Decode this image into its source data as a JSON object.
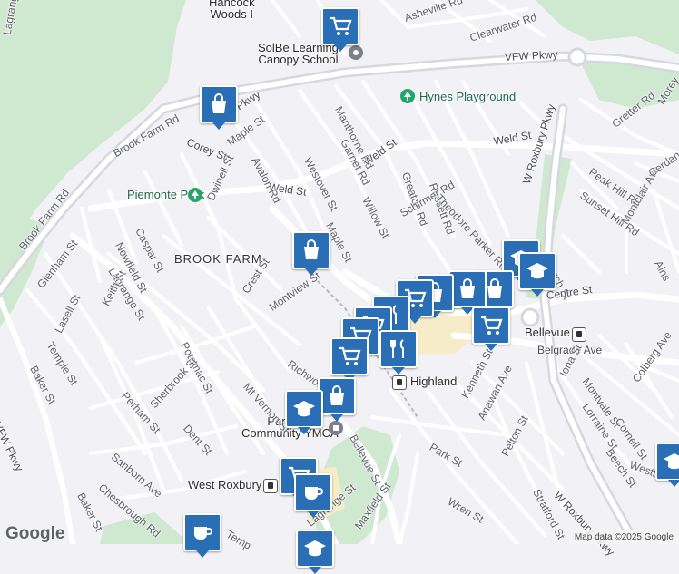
{
  "map": {
    "places": {
      "hancock_woods": "Hancock\nWoods I",
      "solbe": "SolBe Learning\nCanopy School",
      "hynes": "Hynes Playground",
      "piemonte": "Piemonte Park",
      "brook_farm": "BROOK FARM",
      "highland": "Highland",
      "bellevue": "Bellevue",
      "ymca": "Parkway\nCommunity YMCA",
      "west_roxbury": "West Roxbury"
    },
    "streets": {
      "asheville": "Asheville Rd",
      "clearwater": "Clearwater Rd",
      "vfw_top": "VFW Pkwy",
      "vfw_mid": "VFW Pkwy",
      "vfw_left": "VFW Pkwy",
      "lagrange_top": "Lagrange St",
      "lagrange_mid": "Lagrange St",
      "lagrange_bot": "Lagrange St",
      "manthorne": "Manthorne Rd",
      "garnet": "Garnet Rd",
      "weld_right": "Weld St",
      "weld_mid": "Weld St",
      "weld_left": "Weld St",
      "corey": "Corey St",
      "maple_top": "Maple St",
      "maple_mid": "Maple St",
      "avalon": "Avalon Rd",
      "westover": "Westover St",
      "greaton": "Greaton Rd",
      "russett": "Russett Rd",
      "theodore": "Theodore Parker Rd",
      "w_roxbury_top": "W Roxbury Pkwy",
      "w_roxbury_bot": "W Roxbury Pkwy",
      "gretter": "Gretter Rd",
      "morey": "Morey",
      "peak_hill": "Peak Hill Rd",
      "sunset_hill": "Sunset Hill Rd",
      "montclair": "Montclair Ave",
      "cerdan": "Cerdan Av",
      "church": "Church St",
      "ains": "Ains",
      "centre": "Centre St",
      "belgrade": "Belgrade Ave",
      "brook_farm_rd_top": "Brook Farm Rd",
      "brook_farm_rd_left": "Brook Farm Rd",
      "dwinell": "Dwinell St",
      "willow": "Willow St",
      "schirmer": "Schirmer Rd",
      "caspar": "Caspar St",
      "newfield": "Newfield St",
      "glenham": "Glenham St",
      "crest": "Crest St",
      "montview": "Montview St",
      "lasell": "Lasell St",
      "keith": "Keith St",
      "temple": "Temple St",
      "baker_top": "Baker St",
      "baker_bot": "Baker St",
      "potomac": "Potomac St",
      "richwood": "Richwood",
      "mt_vernon": "Mt Vernon St",
      "perham": "Perham St",
      "sherbrook": "Sherbrook St",
      "dent": "Dent St",
      "bellevue_st": "Bellevue St",
      "park": "Park St",
      "wren": "Wren St",
      "maxfield": "Maxfield St",
      "kenneth": "Kenneth St",
      "anawan": "Anawan Ave",
      "pelton": "Pelton St",
      "stratford": "Stratford St",
      "iona": "Iona St",
      "montvale": "Montvale St",
      "lorraine": "Lorraine St",
      "colberg": "Colberg Ave",
      "cornell": "Cornell St",
      "beech": "Beech St",
      "westbo": "Westbo",
      "sanborn": "Sanborn Ave",
      "chesbrough": "Chesbrough Rd",
      "temp": "Temp"
    },
    "markers": [
      {
        "type": "grocery",
        "color": "#2a6fb6"
      },
      {
        "type": "shopping-bag",
        "color": "#2a6fb6"
      },
      {
        "type": "shopping-bag",
        "color": "#2a6fb6"
      },
      {
        "type": "school",
        "color": "#2a6fb6"
      },
      {
        "type": "school",
        "color": "#2a6fb6"
      },
      {
        "type": "shopping-bag",
        "color": "#2a6fb6"
      },
      {
        "type": "shopping-bag",
        "color": "#2a6fb6"
      },
      {
        "type": "grocery",
        "color": "#2a6fb6"
      },
      {
        "type": "grocery",
        "color": "#2a6fb6"
      },
      {
        "type": "restaurant",
        "color": "#2a6fb6"
      },
      {
        "type": "grocery",
        "color": "#2a6fb6"
      },
      {
        "type": "shopping-bag",
        "color": "#2a6fb6"
      },
      {
        "type": "school",
        "color": "#2a6fb6"
      },
      {
        "type": "grocery",
        "color": "#2a6fb6"
      },
      {
        "type": "cafe",
        "color": "#2a6fb6"
      },
      {
        "type": "cafe",
        "color": "#2a6fb6"
      },
      {
        "type": "school",
        "color": "#2a6fb6"
      },
      {
        "type": "school",
        "color": "#2a6fb6"
      }
    ],
    "colors": {
      "park": "#cfe8d0",
      "road_major": "#ffffff",
      "road_highway": "#ffffff",
      "land": "#f2f1f6",
      "commercial": "#f6ecc8",
      "marker": "#2a6fb6"
    }
  },
  "footer": {
    "logo": "Google",
    "attribution": "Map data ©2025 Google"
  }
}
